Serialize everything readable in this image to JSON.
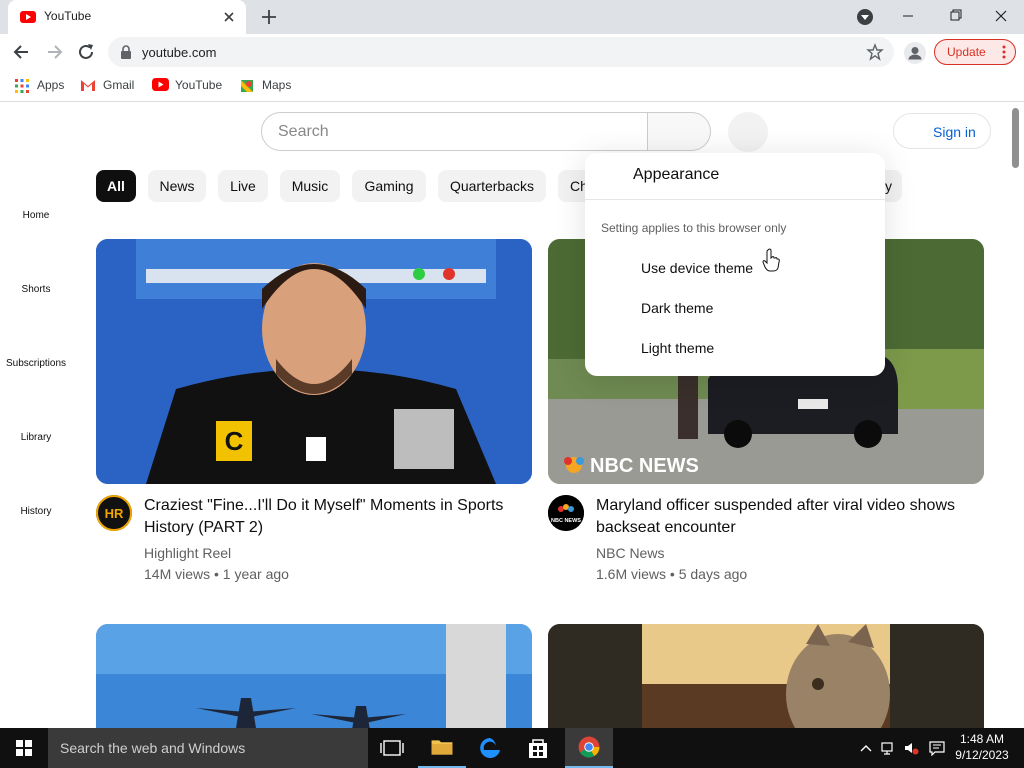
{
  "browser": {
    "tab_title": "YouTube",
    "url": "youtube.com",
    "update_label": "Update",
    "bookmarks": [
      {
        "label": "Apps"
      },
      {
        "label": "Gmail"
      },
      {
        "label": "YouTube"
      },
      {
        "label": "Maps"
      }
    ]
  },
  "youtube": {
    "search_placeholder": "Search",
    "sign_in": "Sign in",
    "chips": [
      "All",
      "News",
      "Live",
      "Music",
      "Gaming",
      "Quarterbacks",
      "Ch",
      "y"
    ],
    "sidebar": [
      "Home",
      "Shorts",
      "Subscriptions",
      "Library",
      "History"
    ],
    "videos": [
      {
        "title": "Craziest \"Fine...I'll Do it Myself\" Moments in Sports History (PART 2)",
        "channel": "Highlight Reel",
        "meta": "14M views • 1 year ago",
        "avatar_text": "HR",
        "thumb_badge": "C"
      },
      {
        "title": "Maryland officer suspended after viral video shows backseat encounter",
        "channel": "NBC News",
        "meta": "1.6M views • 5 days ago",
        "avatar_text": "NBC NEWS",
        "thumb_logo": "NBC NEWS"
      }
    ]
  },
  "appearance_menu": {
    "title": "Appearance",
    "note": "Setting applies to this browser only",
    "options": [
      "Use device theme",
      "Dark theme",
      "Light theme"
    ]
  },
  "taskbar": {
    "search_placeholder": "Search the web and Windows",
    "time": "1:48 AM",
    "date": "9/12/2023"
  },
  "colors": {
    "youtube_red": "#ff0000",
    "link_blue": "#065fd4",
    "update_red": "#d93025",
    "taskbar": "#101010"
  }
}
